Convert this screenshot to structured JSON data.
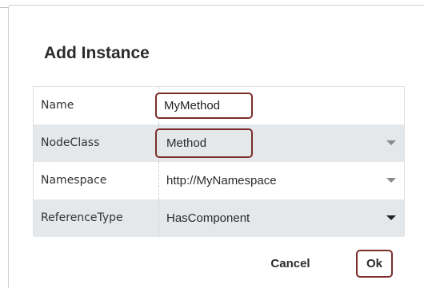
{
  "dialog": {
    "title": "Add Instance"
  },
  "properties": [
    {
      "label": "Name",
      "value": "MyMethod",
      "type": "input"
    },
    {
      "label": "NodeClass",
      "value": "Method",
      "type": "select"
    },
    {
      "label": "Namespace",
      "value": "http://MyNamespace",
      "type": "select"
    },
    {
      "label": "ReferenceType",
      "value": "HasComponent",
      "type": "select"
    }
  ],
  "actions": {
    "cancel_label": "Cancel",
    "ok_label": "Ok"
  },
  "colors": {
    "highlight_border": "#7a2e2a",
    "row_alt_background": "#e4e8eb"
  }
}
